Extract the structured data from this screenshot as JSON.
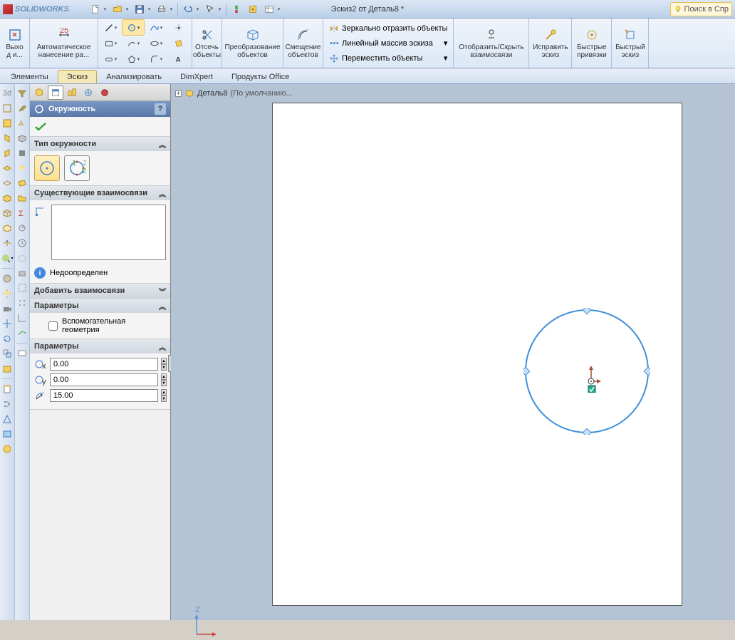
{
  "titlebar": {
    "app": "SOLIDWORKS",
    "document": "Эскиз2 от Деталь8 *",
    "search_placeholder": "Поиск в Спр"
  },
  "ribbon": {
    "exit": "Выхо\nд и...",
    "auto_dim": "Автоматическое\nнанесение ра...",
    "trim": "Отсечь\nобъекты",
    "convert": "Преобразование\nобъектов",
    "offset": "Смещение\nобъектов",
    "mirror": "Зеркально отразить объекты",
    "pattern": "Линейный массив эскиза",
    "move": "Переместить объекты",
    "display_rel": "Отобразить/Скрыть\nвзаимосвязи",
    "repair": "Исправить\nэскиз",
    "quick_snaps": "Быстрые\nпривязки",
    "rapid_sketch": "Быстрый\nэскиз"
  },
  "tabs": {
    "features": "Элементы",
    "sketch": "Эскиз",
    "evaluate": "Анализировать",
    "dimxpert": "DimXpert",
    "office": "Продукты Office"
  },
  "breadcrumb": {
    "doc": "Деталь8",
    "config": "(По умолчанию..."
  },
  "pm": {
    "title": "Окружность",
    "help": "?",
    "sec_type": "Тип окружности",
    "sec_existing": "Существующие взаимосвязи",
    "status": "Недоопределен",
    "sec_add": "Добавить взаимосвязи",
    "sec_options": "Параметры",
    "construction": "Вспомогательная\nгеометрия",
    "sec_params": "Параметры",
    "params": {
      "cx": "0.00",
      "cy": "0.00",
      "r": "15.00"
    }
  },
  "axis": {
    "z": "Z"
  }
}
